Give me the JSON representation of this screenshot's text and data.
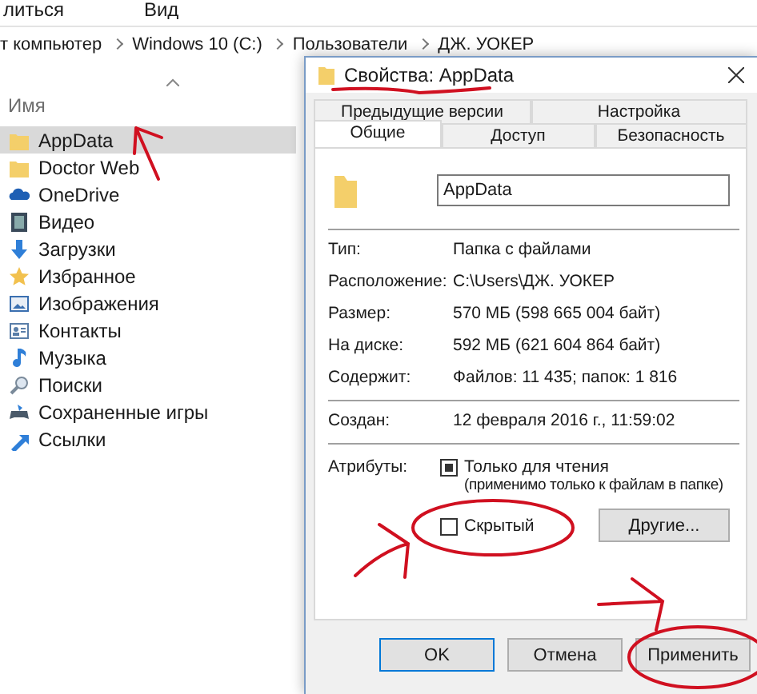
{
  "explorer": {
    "menu": [
      "литься",
      "Вид"
    ],
    "breadcrumb": [
      "т компьютер",
      "Windows 10 (C:)",
      "Пользователи",
      "ДЖ. УОКЕР"
    ],
    "column": "Имя",
    "items": [
      {
        "name": "AppData",
        "kind": "folder",
        "selected": true
      },
      {
        "name": "Doctor Web",
        "kind": "folder",
        "selected": false
      },
      {
        "name": "OneDrive",
        "kind": "cloud",
        "selected": false
      },
      {
        "name": "Видео",
        "kind": "video",
        "selected": false
      },
      {
        "name": "Загрузки",
        "kind": "download",
        "selected": false
      },
      {
        "name": "Избранное",
        "kind": "star",
        "selected": false
      },
      {
        "name": "Изображения",
        "kind": "pictures",
        "selected": false
      },
      {
        "name": "Контакты",
        "kind": "contacts",
        "selected": false
      },
      {
        "name": "Музыка",
        "kind": "music",
        "selected": false
      },
      {
        "name": "Поиски",
        "kind": "search",
        "selected": false
      },
      {
        "name": "Сохраненные игры",
        "kind": "games",
        "selected": false
      },
      {
        "name": "Ссылки",
        "kind": "link",
        "selected": false
      }
    ]
  },
  "dialog": {
    "title": "Свойства: AppData",
    "tabs_back": [
      {
        "label": "Предыдущие версии",
        "selected": false
      },
      {
        "label": "Настройка",
        "selected": false
      }
    ],
    "tabs_front": [
      {
        "label": "Общие",
        "selected": true
      },
      {
        "label": "Доступ",
        "selected": false
      },
      {
        "label": "Безопасность",
        "selected": false
      }
    ],
    "name_value": "AppData",
    "groups": [
      [
        {
          "label": "Тип:",
          "value": "Папка с файлами"
        },
        {
          "label": "Расположение:",
          "value": "C:\\Users\\ДЖ. УОКЕР"
        },
        {
          "label": "Размер:",
          "value": "570 МБ (598 665 004 байт)"
        },
        {
          "label": "На диске:",
          "value": "592 МБ (621 604 864 байт)"
        },
        {
          "label": "Содержит:",
          "value": "Файлов: 11 435; папок: 1 816"
        }
      ],
      [
        {
          "label": "Создан:",
          "value": "12 февраля 2016 г., 11:59:02"
        }
      ]
    ],
    "attributes_label": "Атрибуты:",
    "attributes": [
      {
        "label": "Только для чтения",
        "note": "(применимо только к файлам в папке)",
        "indeterminate": true
      },
      {
        "label": "Скрытый",
        "checked": false,
        "indeterminate": false
      }
    ],
    "other_button": "Другие...",
    "buttons": [
      {
        "label": "OK",
        "default": true
      },
      {
        "label": "Отмена",
        "default": false
      },
      {
        "label": "Применить",
        "default": false
      }
    ]
  }
}
